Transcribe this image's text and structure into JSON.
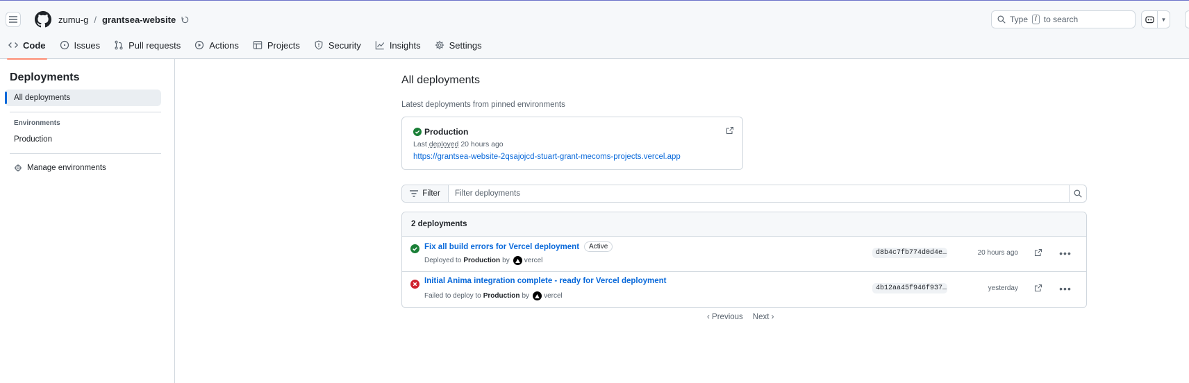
{
  "header": {
    "owner": "zumu-g",
    "separator": "/",
    "repo": "grantsea-website",
    "search_prefix": "Type",
    "search_key": "/",
    "search_suffix": "to search"
  },
  "tabs": [
    {
      "label": "Code",
      "icon": "code-icon"
    },
    {
      "label": "Issues",
      "icon": "issue-icon"
    },
    {
      "label": "Pull requests",
      "icon": "pull-request-icon"
    },
    {
      "label": "Actions",
      "icon": "play-icon"
    },
    {
      "label": "Projects",
      "icon": "table-icon"
    },
    {
      "label": "Security",
      "icon": "shield-icon"
    },
    {
      "label": "Insights",
      "icon": "graph-icon"
    },
    {
      "label": "Settings",
      "icon": "gear-icon"
    }
  ],
  "sidebar": {
    "title": "Deployments",
    "all_label": "All deployments",
    "env_heading": "Environments",
    "env_item": "Production",
    "manage_label": "Manage environments"
  },
  "main": {
    "title": "All deployments",
    "subtitle": "Latest deployments from pinned environments",
    "pinned": {
      "env": "Production",
      "meta_prefix": "Last",
      "meta_deployed": "deployed",
      "meta_time": "20 hours ago",
      "url": "https://grantsea-website-2qsajojcd-stuart-grant-mecoms-projects.vercel.app"
    },
    "filter": {
      "button": "Filter",
      "placeholder": "Filter deployments"
    },
    "list": {
      "count_label": "2 deployments",
      "rows": [
        {
          "status": "success",
          "title": "Fix all build errors for Vercel deployment",
          "badge": "Active",
          "sub_prefix": "Deployed to",
          "env": "Production",
          "by": "by",
          "actor": "vercel",
          "sha": "d8b4c7fb774d0d4e…",
          "when": "20 hours ago"
        },
        {
          "status": "failure",
          "title": "Initial Anima integration complete - ready for Vercel deployment",
          "badge": "",
          "sub_prefix": "Failed to deploy to",
          "env": "Production",
          "by": "by",
          "actor": "vercel",
          "sha": "4b12aa45f946f937…",
          "when": "yesterday"
        }
      ]
    },
    "pager": {
      "prev": "Previous",
      "next": "Next"
    }
  },
  "colors": {
    "accent": "#0969da",
    "success": "#1a7f37",
    "danger": "#cf222e",
    "tab_underline": "#fd8c73"
  }
}
